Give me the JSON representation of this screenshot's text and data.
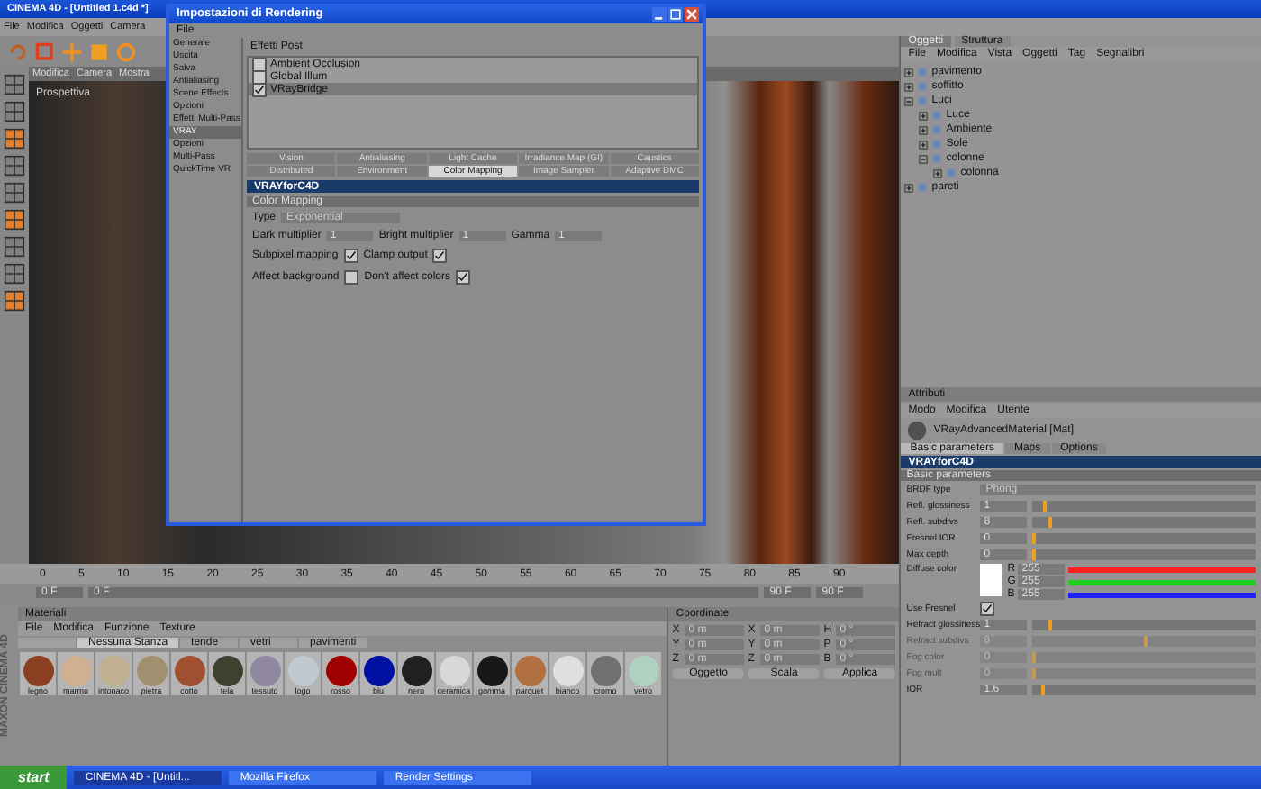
{
  "app": {
    "title": "CINEMA 4D - [Untitled 1.c4d *]",
    "menu": [
      "File",
      "Modifica",
      "Oggetti",
      "Camera"
    ]
  },
  "viewport": {
    "menu": [
      "Modifica",
      "Camera",
      "Mostra"
    ],
    "label": "Prospettiva"
  },
  "dialog": {
    "title": "Impostazioni di Rendering",
    "menu": [
      "File"
    ],
    "sidebar": [
      {
        "label": "Generale",
        "selected": false
      },
      {
        "label": "Uscita",
        "selected": false
      },
      {
        "label": "Salva",
        "selected": false
      },
      {
        "label": "Antialiasing",
        "selected": false
      },
      {
        "label": "Scene Effects",
        "selected": false
      },
      {
        "label": "Opzioni",
        "selected": false
      },
      {
        "label": "Effetti Multi-Pass",
        "selected": false
      },
      {
        "label": "VRAY",
        "selected": true
      },
      {
        "label": "Opzioni",
        "selected": false
      },
      {
        "label": "Multi-Pass",
        "selected": false
      },
      {
        "label": "QuickTime VR",
        "selected": false
      }
    ],
    "effects_header": "Effetti Post",
    "renderers": [
      {
        "label": "Ambient Occlusion",
        "checked": false,
        "selected": false
      },
      {
        "label": "Global Illum",
        "checked": false,
        "selected": false
      },
      {
        "label": "VRayBridge",
        "checked": true,
        "selected": true
      }
    ],
    "tabs": [
      [
        {
          "label": "Vision",
          "selected": false
        },
        {
          "label": "Antialiasing",
          "selected": false
        },
        {
          "label": "Light Cache",
          "selected": false
        },
        {
          "label": "Irradiance Map (GI)",
          "selected": false
        },
        {
          "label": "Caustics",
          "selected": false
        }
      ],
      [
        {
          "label": "Distributed",
          "selected": false
        },
        {
          "label": "Environment",
          "selected": false
        },
        {
          "label": "Color Mapping",
          "selected": true
        },
        {
          "label": "Image Sampler",
          "selected": false
        },
        {
          "label": "Adaptive DMC",
          "selected": false
        }
      ]
    ],
    "plugin": "VRAYforC4D",
    "section": "Color Mapping",
    "type": {
      "label": "Type",
      "value": "Exponential"
    },
    "fields": [
      {
        "label": "Dark multiplier",
        "value": "1"
      },
      {
        "label": "Bright multiplier",
        "value": "1"
      },
      {
        "label": "Gamma",
        "value": "1"
      }
    ],
    "checks": [
      [
        {
          "label": "Subpixel mapping",
          "checked": true
        },
        {
          "label": "Clamp output",
          "checked": true
        }
      ],
      [
        {
          "label": "Affect background",
          "checked": false
        },
        {
          "label": "Don't affect colors",
          "checked": true
        }
      ]
    ]
  },
  "objects": {
    "tabs": [
      {
        "label": "Oggetti",
        "selected": true
      },
      {
        "label": "Struttura",
        "selected": false
      }
    ],
    "menu": [
      "File",
      "Modifica",
      "Vista",
      "Oggetti",
      "Tag",
      "Segnalibri"
    ],
    "tree": [
      {
        "name": "pavimento",
        "expanded": false
      },
      {
        "name": "soffitto",
        "expanded": false
      },
      {
        "name": "Luci",
        "expanded": true,
        "children": [
          {
            "name": "Luce",
            "expanded": false
          },
          {
            "name": "Ambiente",
            "expanded": false
          },
          {
            "name": "Sole",
            "expanded": false
          },
          {
            "name": "colonne",
            "expanded": true,
            "children": [
              {
                "name": "colonna",
                "expanded": false
              }
            ]
          }
        ]
      },
      {
        "name": "pareti",
        "expanded": false
      }
    ]
  },
  "attributes": {
    "header": "Attributi",
    "menu": [
      "Modo",
      "Modifica",
      "Utente"
    ],
    "title": "VRayAdvancedMaterial [Mat]",
    "tabs": [
      {
        "label": "Basic parameters",
        "selected": true
      },
      {
        "label": "Maps",
        "selected": false
      },
      {
        "label": "Options",
        "selected": false
      }
    ],
    "plugin": "VRAYforC4D",
    "section": "Basic parameters",
    "rows": [
      {
        "kind": "dropdown",
        "label": "BRDF type",
        "value": "Phong"
      },
      {
        "kind": "slider",
        "label": "Refl. glossiness",
        "value": "1",
        "level": 0.05,
        "disabled": false
      },
      {
        "kind": "slider",
        "label": "Refl. subdivs",
        "value": "8",
        "level": 0.07,
        "disabled": false
      },
      {
        "kind": "slider",
        "label": "Fresnel IOR",
        "value": "0",
        "level": 0,
        "disabled": false
      },
      {
        "kind": "slider",
        "label": "Max depth",
        "value": "0",
        "level": 0,
        "disabled": false
      },
      {
        "kind": "color",
        "label": "Diffuse color",
        "channels": [
          {
            "name": "R",
            "value": "255",
            "color": "#ff2020",
            "level": 1
          },
          {
            "name": "G",
            "value": "255",
            "color": "#20d020",
            "level": 1
          },
          {
            "name": "B",
            "value": "255",
            "color": "#2020ff",
            "level": 1
          }
        ]
      },
      {
        "kind": "check",
        "label": "Use Fresnel",
        "checked": true
      },
      {
        "kind": "slider",
        "label": "Refract glossiness",
        "value": "1",
        "level": 0.07,
        "disabled": false
      },
      {
        "kind": "slider",
        "label": "Refract subdivs",
        "value": "8",
        "level": 0.5,
        "disabled": true
      },
      {
        "kind": "slider",
        "label": "Fog color",
        "value": "0",
        "level": 0,
        "disabled": true
      },
      {
        "kind": "slider",
        "label": "Fog mult",
        "value": "0",
        "level": 0,
        "disabled": true
      },
      {
        "kind": "slider",
        "label": "IOR",
        "value": "1.6",
        "level": 0.04,
        "disabled": false
      }
    ]
  },
  "timeline": {
    "ticks": [
      "0",
      "5",
      "10",
      "15",
      "20",
      "25",
      "30",
      "35",
      "40",
      "45",
      "50",
      "55",
      "60",
      "65",
      "70",
      "75",
      "80",
      "85",
      "90"
    ],
    "start": "0 F",
    "current": "0 F",
    "end": "90 F",
    "fps": "90 F"
  },
  "materials": {
    "header": "Materiali",
    "menu": [
      "File",
      "Modifica",
      "Funzione",
      "Texture"
    ],
    "tabs": [
      {
        "selected": false
      },
      {
        "label": "Nessuna Stanza",
        "selected": true
      },
      {
        "label": "tende",
        "selected": false
      },
      {
        "label": "vetri",
        "selected": false
      },
      {
        "label": "pavimenti",
        "selected": false
      }
    ],
    "items": [
      {
        "name": "legno",
        "color": "#8a4020"
      },
      {
        "name": "marmo",
        "color": "#d0b090"
      },
      {
        "name": "intonaco",
        "color": "#c0b090"
      },
      {
        "name": "pietra",
        "color": "#a09070"
      },
      {
        "name": "cotto",
        "color": "#a05030"
      },
      {
        "name": "tela",
        "color": "#404030"
      },
      {
        "name": "tessuto",
        "color": "#9088a0"
      },
      {
        "name": "logo",
        "color": "#c0c8d0"
      },
      {
        "name": "rosso",
        "color": "#a00000"
      },
      {
        "name": "blu",
        "color": "#0010a0"
      },
      {
        "name": "nero",
        "color": "#202020"
      },
      {
        "name": "ceramica",
        "color": "#d8d8d8"
      },
      {
        "name": "gomma",
        "color": "#181818"
      },
      {
        "name": "parquet",
        "color": "#b07040"
      },
      {
        "name": "bianco",
        "color": "#e0e0e0"
      },
      {
        "name": "cromo",
        "color": "#707070"
      },
      {
        "name": "vetro",
        "color": "#b0d0c0"
      }
    ]
  },
  "coords": {
    "header": "Coordinate",
    "rows": [
      [
        "0 m",
        "0 m",
        "0 °"
      ],
      [
        "0 m",
        "0 m",
        "0 °"
      ],
      [
        "0 m",
        "0 m",
        "0 °"
      ]
    ],
    "axes": [
      [
        "X",
        "X",
        "H"
      ],
      [
        "Y",
        "Y",
        "P"
      ],
      [
        "Z",
        "Z",
        "B"
      ]
    ],
    "mode": "Oggetto",
    "size": "Scala",
    "apply": "Applica"
  },
  "taskbar": {
    "start": "start",
    "items": [
      {
        "label": "CINEMA 4D - [Untitl...",
        "selected": true
      },
      {
        "label": "Mozilla Firefox",
        "selected": false
      },
      {
        "label": "Render Settings",
        "selected": false
      }
    ]
  },
  "brand": "MAXON CINEMA 4D"
}
